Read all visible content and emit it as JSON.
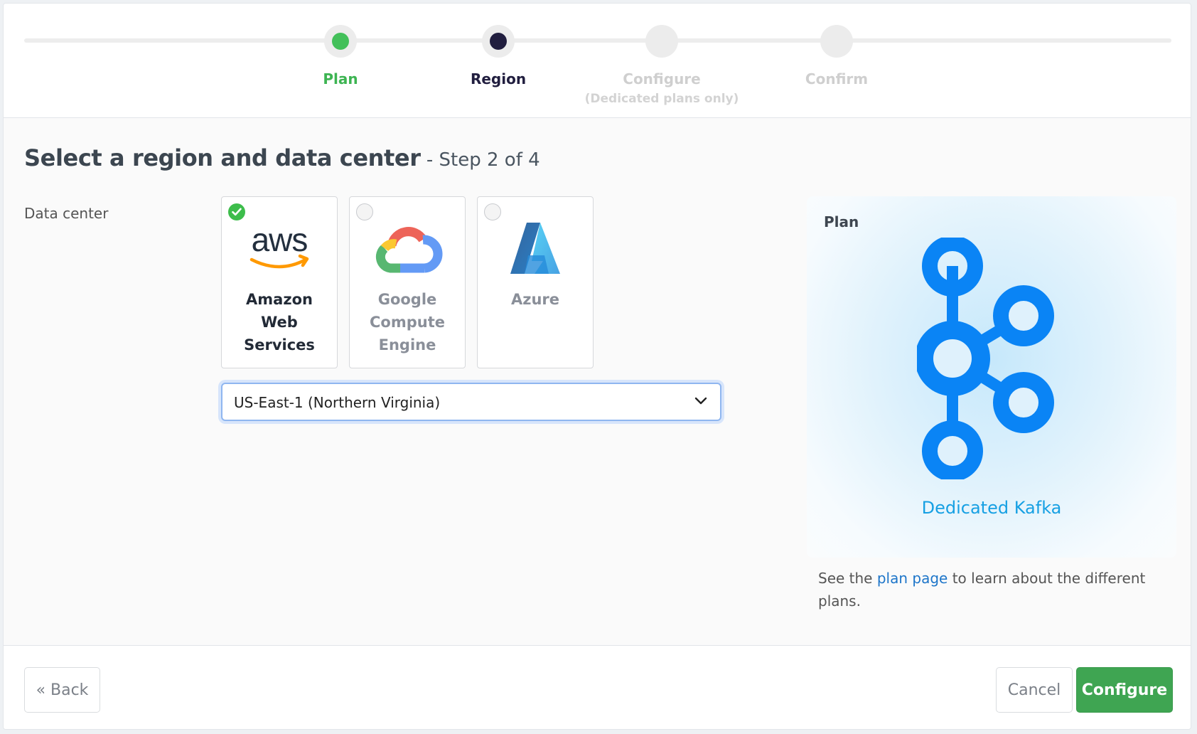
{
  "stepper": {
    "steps": [
      {
        "label": "Plan",
        "sublabel": "",
        "state": "complete"
      },
      {
        "label": "Region",
        "sublabel": "",
        "state": "current"
      },
      {
        "label": "Configure",
        "sublabel": "(Dedicated plans only)",
        "state": "pending"
      },
      {
        "label": "Confirm",
        "sublabel": "",
        "state": "pending"
      }
    ]
  },
  "heading": {
    "title": "Select a region and data center",
    "step": " - Step 2 of 4"
  },
  "data_center": {
    "label": "Data center",
    "providers": [
      {
        "name": "Amazon Web Services",
        "icon": "aws-logo-icon",
        "selected": true
      },
      {
        "name": "Google Compute Engine",
        "icon": "google-cloud-logo-icon",
        "selected": false
      },
      {
        "name": "Azure",
        "icon": "azure-logo-icon",
        "selected": false
      }
    ],
    "region_select": {
      "value": "US-East-1 (Northern Virginia)"
    }
  },
  "plan": {
    "title": "Plan",
    "icon": "kafka-logo-icon",
    "name": "Dedicated Kafka",
    "note_before": "See the ",
    "note_link": "plan page",
    "note_after": " to learn about the different plans."
  },
  "footer": {
    "back_label": "« Back",
    "cancel_label": "Cancel",
    "configure_label": "Configure"
  },
  "colors": {
    "complete": "#43c05a",
    "current": "#211e3f",
    "primary_button": "#3fa552",
    "link": "#1d75c9",
    "plan_name": "#16a0e3"
  }
}
